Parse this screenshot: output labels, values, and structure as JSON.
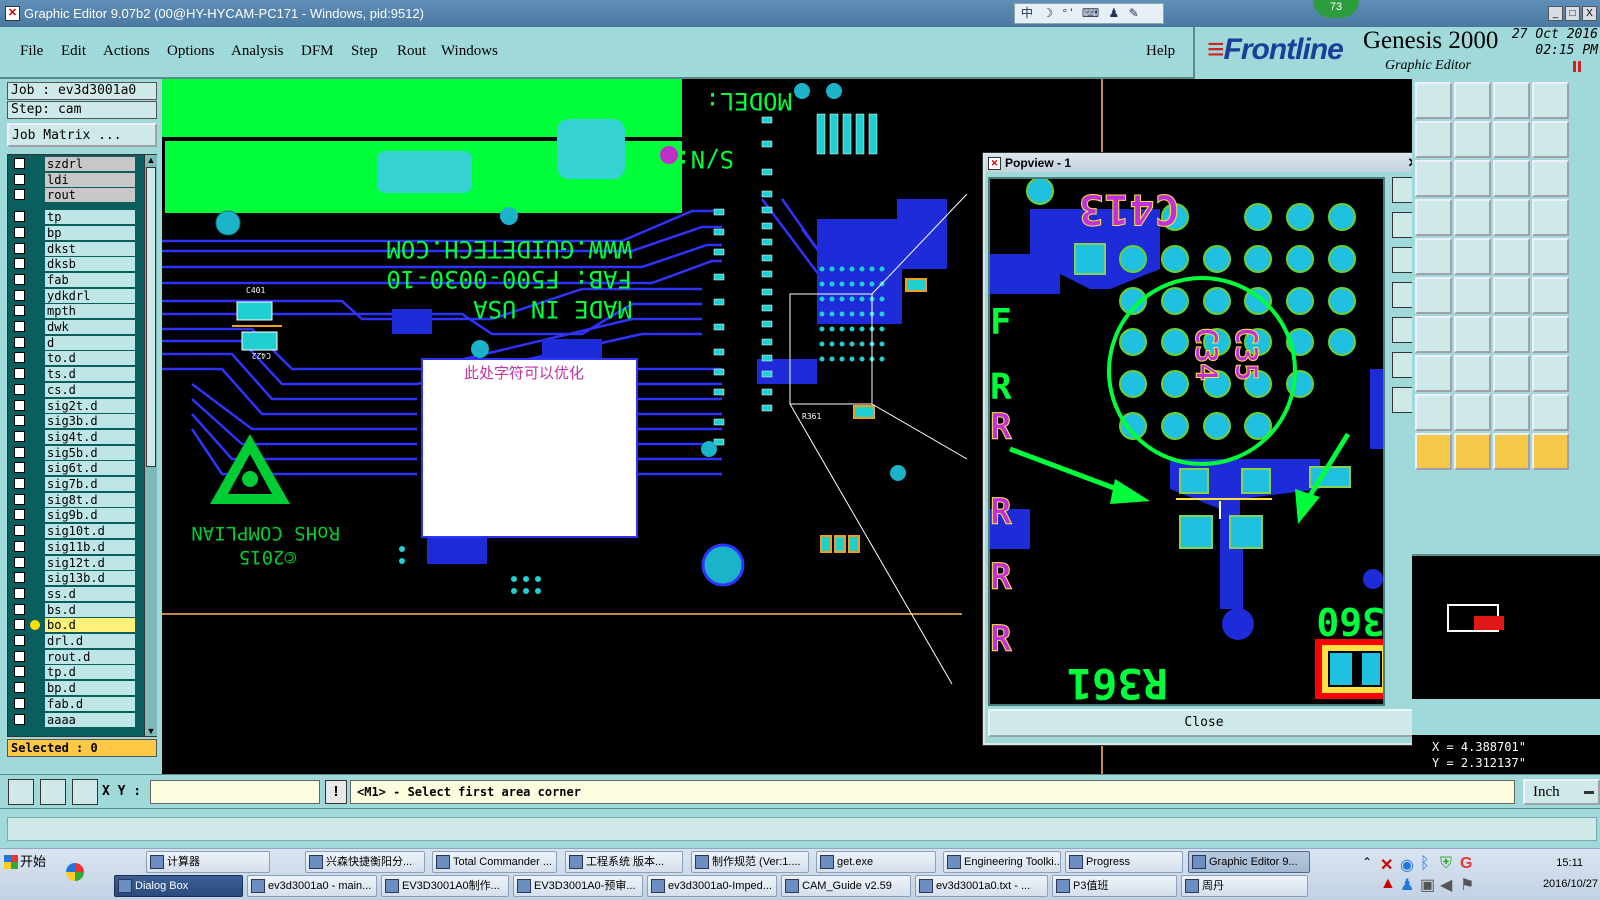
{
  "window": {
    "title": "Graphic Editor 9.07b2 (00@HY-HYCAM-PC171 - Windows, pid:9512)",
    "ime_text": "中 ☽ °' ⌨ ♟ ✎",
    "ime_badge": "73",
    "min_btn": "_",
    "max_btn": "□",
    "close_btn": "X"
  },
  "menu": {
    "items": [
      "File",
      "Edit",
      "Actions",
      "Options",
      "Analysis",
      "DFM",
      "Step",
      "Rout",
      "Windows"
    ],
    "help": "Help"
  },
  "brand": {
    "logo_mark": "≡",
    "logo": "Frontline",
    "product": "Genesis 2000",
    "subtitle": "Graphic Editor",
    "date": "27 Oct 2016",
    "time": "02:15 PM"
  },
  "job": {
    "job_line": "Job : ev3d3001a0",
    "step_line": "Step: cam",
    "matrix_btn": "Job Matrix ..."
  },
  "layers": [
    {
      "name": "szdrl",
      "style": "gray"
    },
    {
      "name": "ldi",
      "style": "gray"
    },
    {
      "name": "rout",
      "style": "gray"
    },
    {
      "name": "tp",
      "style": "normal"
    },
    {
      "name": "bp",
      "style": "normal"
    },
    {
      "name": "dkst",
      "style": "normal"
    },
    {
      "name": "dksb",
      "style": "normal"
    },
    {
      "name": "fab",
      "style": "normal"
    },
    {
      "name": "ydkdrl",
      "style": "normal"
    },
    {
      "name": "mpth",
      "style": "normal"
    },
    {
      "name": "dwk",
      "style": "normal"
    },
    {
      "name": "d",
      "style": "normal"
    },
    {
      "name": "to.d",
      "style": "normal"
    },
    {
      "name": "ts.d",
      "style": "normal"
    },
    {
      "name": "cs.d",
      "style": "normal"
    },
    {
      "name": "sig2t.d",
      "style": "normal"
    },
    {
      "name": "sig3b.d",
      "style": "normal"
    },
    {
      "name": "sig4t.d",
      "style": "normal"
    },
    {
      "name": "sig5b.d",
      "style": "normal"
    },
    {
      "name": "sig6t.d",
      "style": "normal"
    },
    {
      "name": "sig7b.d",
      "style": "normal"
    },
    {
      "name": "sig8t.d",
      "style": "normal"
    },
    {
      "name": "sig9b.d",
      "style": "normal"
    },
    {
      "name": "sig10t.d",
      "style": "normal"
    },
    {
      "name": "sig11b.d",
      "style": "normal"
    },
    {
      "name": "sig12t.d",
      "style": "normal"
    },
    {
      "name": "sig13b.d",
      "style": "normal"
    },
    {
      "name": "ss.d",
      "style": "normal"
    },
    {
      "name": "bs.d",
      "style": "normal"
    },
    {
      "name": "bo.d",
      "style": "yel"
    },
    {
      "name": "drl.d",
      "style": "normal"
    },
    {
      "name": "rout.d",
      "style": "normal"
    },
    {
      "name": "tp.d",
      "style": "normal"
    },
    {
      "name": "bp.d",
      "style": "normal"
    },
    {
      "name": "fab.d",
      "style": "normal"
    },
    {
      "name": "aaaa",
      "style": "normal"
    }
  ],
  "selected_text": "Selected : 0",
  "board": {
    "model_text": "MODEL:",
    "sn_text": "S/N:",
    "url_text": "WWW.GUIDETECH.COM",
    "fab_text": "FAB: F500-0030-10",
    "made_text": "MADE IN USA",
    "rohs_text": "RoHS COMPLIAN",
    "year_text": "©2015",
    "note_text": "此处字符可以优化",
    "ref_c401": "C401",
    "ref_c422": "C422",
    "ref_r361": "R361"
  },
  "popview": {
    "title": "Popview - 1",
    "close_btn": "Close",
    "circle_text_1": "C35",
    "circle_text_2": "C34",
    "top_text": "C413",
    "bottom_text": "R361",
    "right_text": "360"
  },
  "coords": {
    "x_line": "X = 4.388701\"",
    "y_line": "Y = 2.312137\""
  },
  "cmd": {
    "xy_label": "X Y :",
    "xy_value": "",
    "warn": "!",
    "prompt": "<M1> - Select first area corner",
    "unit": "Inch"
  },
  "taskbar": {
    "start": "开始",
    "row1": [
      "计算器",
      "兴森快捷衡阳分...",
      "Total Commander ...",
      "工程系统  版本...",
      "制作规范 (Ver:1....",
      "get.exe",
      "Engineering Toolki...",
      "Progress",
      "Graphic Editor 9..."
    ],
    "row2": [
      "Dialog Box",
      "ev3d3001a0 - main...",
      "EV3D3001A0制作...",
      "EV3D3001A0-预审...",
      "ev3d3001a0-Imped...",
      "CAM_Guide v2.59",
      "ev3d3001a0.txt - ...",
      "P3值班",
      "周丹"
    ],
    "time": "15:11",
    "date": "2016/10/27"
  }
}
